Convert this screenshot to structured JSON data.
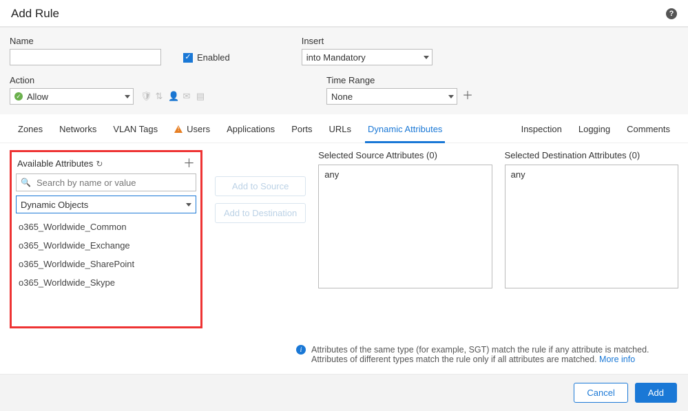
{
  "header": {
    "title": "Add Rule"
  },
  "form": {
    "name_label": "Name",
    "name_value": "",
    "enabled_label": "Enabled",
    "enabled_checked": true,
    "insert_label": "Insert",
    "insert_value": "into Mandatory",
    "action_label": "Action",
    "action_value": "Allow",
    "time_range_label": "Time Range",
    "time_range_value": "None"
  },
  "tabs": {
    "left": [
      "Zones",
      "Networks",
      "VLAN Tags",
      "Users",
      "Applications",
      "Ports",
      "URLs",
      "Dynamic Attributes"
    ],
    "right": [
      "Inspection",
      "Logging",
      "Comments"
    ],
    "active": "Dynamic Attributes",
    "warning_on": "Users"
  },
  "available": {
    "title": "Available Attributes",
    "search_placeholder": "Search by name or value",
    "type_selected": "Dynamic Objects",
    "items": [
      "o365_Worldwide_Common",
      "o365_Worldwide_Exchange",
      "o365_Worldwide_SharePoint",
      "o365_Worldwide_Skype"
    ]
  },
  "buttons": {
    "add_source": "Add to Source",
    "add_destination": "Add to Destination"
  },
  "selected": {
    "source_label": "Selected Source Attributes (0)",
    "source_value": "any",
    "dest_label": "Selected Destination Attributes (0)",
    "dest_value": "any"
  },
  "hint": {
    "line1": "Attributes of the same type (for example, SGT) match the rule if any attribute is matched.",
    "line2": "Attributes of different types match the rule only if all attributes are matched. ",
    "link": "More info"
  },
  "footer": {
    "cancel": "Cancel",
    "add": "Add"
  }
}
